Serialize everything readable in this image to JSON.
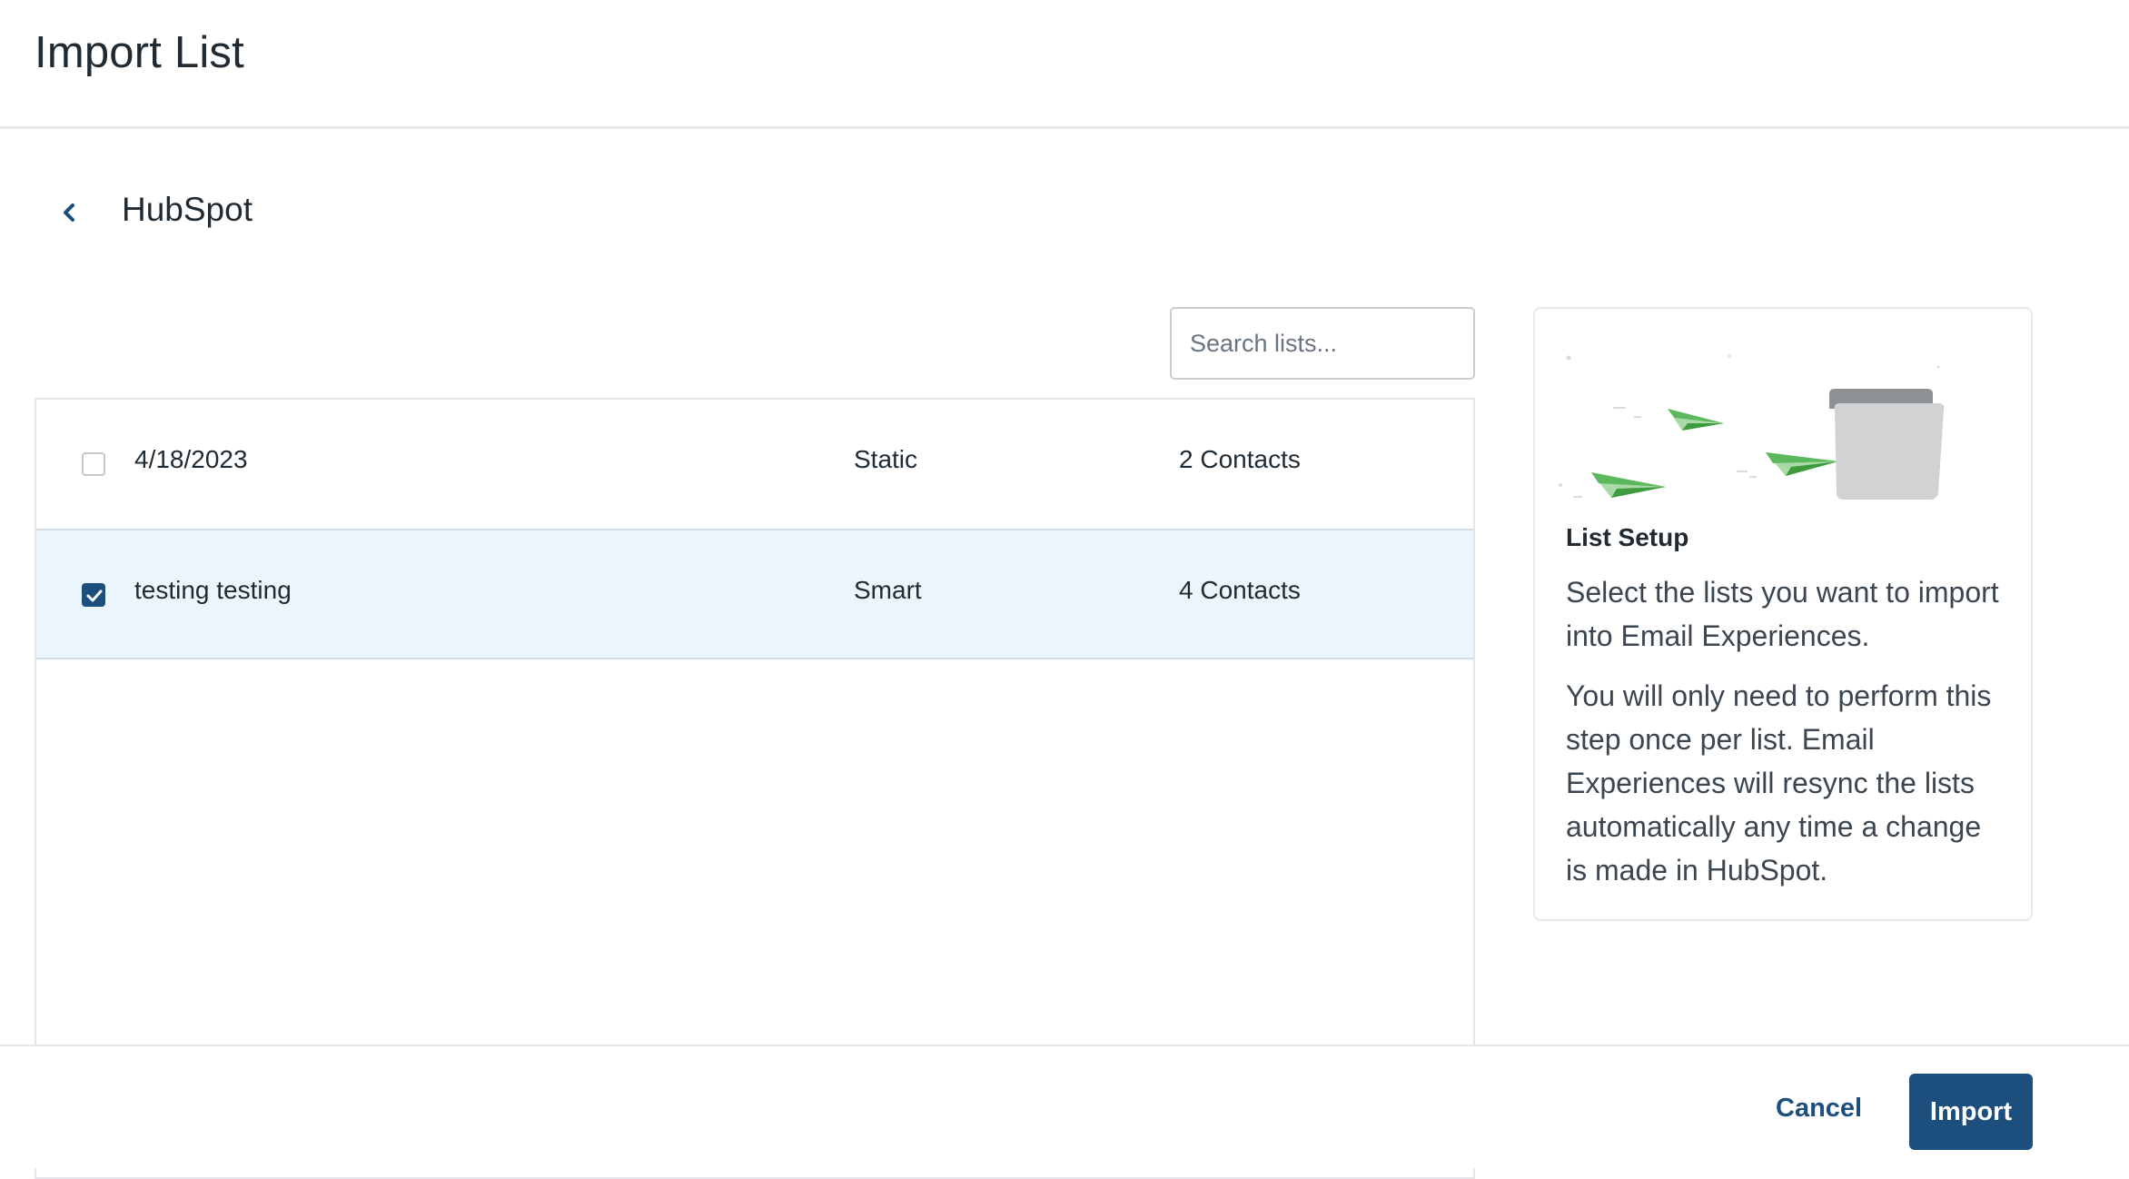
{
  "header": {
    "title": "Import List"
  },
  "nav": {
    "back_icon": "chevron-left-icon",
    "integration_name": "HubSpot"
  },
  "search": {
    "placeholder": "Search lists..."
  },
  "lists": [
    {
      "name": "4/18/2023",
      "type": "Static",
      "count": "2 Contacts",
      "selected": false
    },
    {
      "name": "testing testing",
      "type": "Smart",
      "count": "4 Contacts",
      "selected": true
    }
  ],
  "info_card": {
    "illustration": "paper-planes-folder-illustration",
    "heading": "List Setup",
    "paragraph_1": "Select the lists you want to import into Email Experiences.",
    "paragraph_2": "You will only need to perform this step once per list. Email Experiences will resync the lists automatically any time a change is made in HubSpot."
  },
  "footer": {
    "cancel_label": "Cancel",
    "import_label": "Import"
  },
  "colors": {
    "primary": "#1d4f7e",
    "selected_row": "#eaf5fc",
    "border": "#e4e6e9",
    "illustration_green": "#5cb85c"
  }
}
